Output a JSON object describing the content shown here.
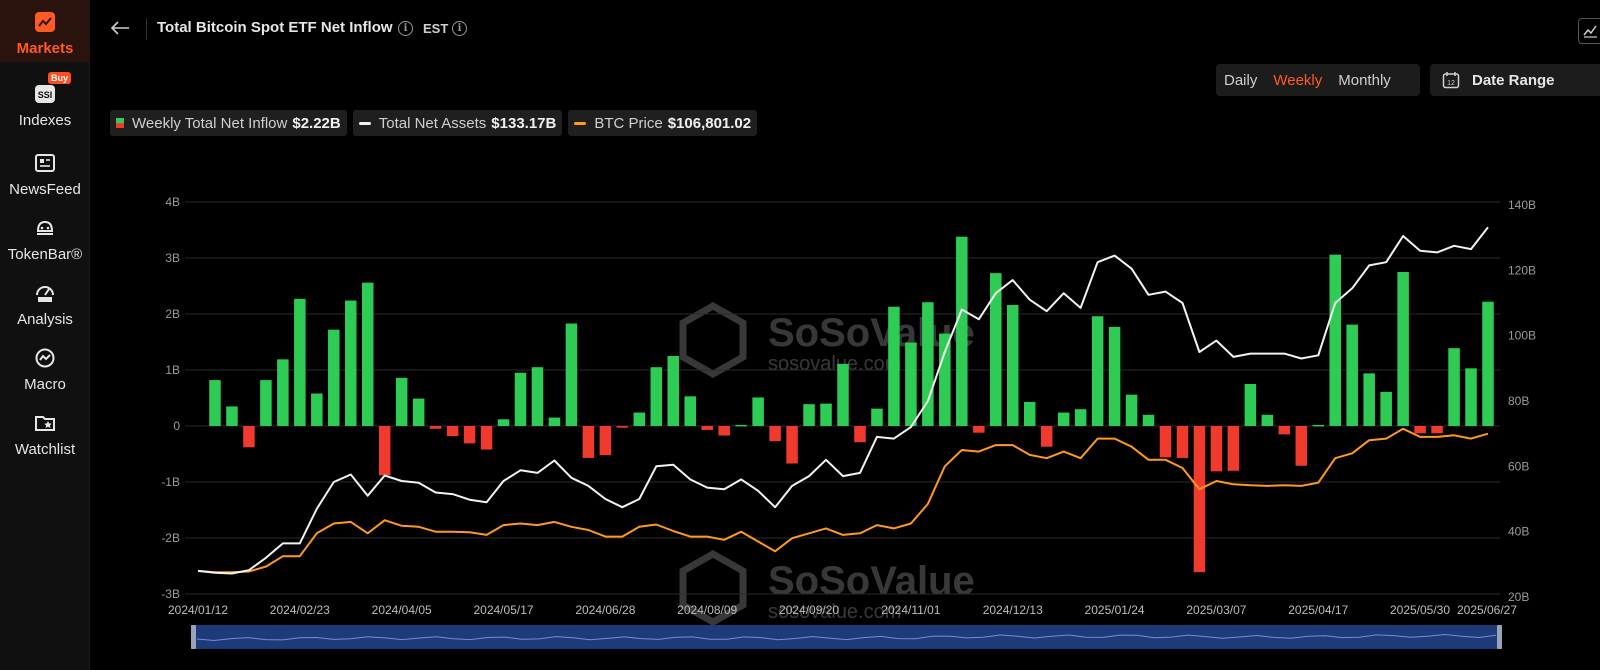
{
  "sidebar": {
    "items": [
      {
        "label": "Markets",
        "icon": "chart-trend-icon",
        "active": true
      },
      {
        "label": "Indexes",
        "icon": "ssi-index-icon",
        "badge": "Buy"
      },
      {
        "label": "NewsFeed",
        "icon": "newspaper-icon"
      },
      {
        "label": "TokenBar®",
        "icon": "tokenbar-icon"
      },
      {
        "label": "Analysis",
        "icon": "data-gauge-icon"
      },
      {
        "label": "Macro",
        "icon": "macro-icon"
      },
      {
        "label": "Watchlist",
        "icon": "watchlist-folder-icon"
      }
    ]
  },
  "header": {
    "title": "Total Bitcoin Spot ETF Net Inflow",
    "timezone": "EST"
  },
  "period_tabs": [
    {
      "label": "Daily",
      "active": false
    },
    {
      "label": "Weekly",
      "active": true
    },
    {
      "label": "Monthly",
      "active": false
    }
  ],
  "date_range": {
    "label": "Date Range",
    "icon_text": "12"
  },
  "legend": [
    {
      "name": "Weekly Total Net Inflow",
      "value": "$2.22B"
    },
    {
      "name": "Total Net Assets",
      "value": "$133.17B"
    },
    {
      "name": "BTC Price",
      "value": "$106,801.02"
    }
  ],
  "watermark": {
    "brand": "SoSoValue",
    "domain": "sosovalue.com"
  },
  "colors": {
    "accent": "#ff5a24",
    "inflow_positive": "#2ecc55",
    "inflow_negative": "#f03a2e",
    "net_assets_line": "#f2f2f2",
    "btc_price_line": "#ff9a1f"
  },
  "chart_data": {
    "type": "bar",
    "title": "Total Bitcoin Spot ETF Net Inflow",
    "left_axis": {
      "ticks": [
        "-3B",
        "-2B",
        "-1B",
        "0",
        "1B",
        "2B",
        "3B",
        "4B"
      ],
      "range": [
        -3,
        4
      ],
      "unit": "B"
    },
    "right_axis": {
      "ticks": [
        "20B",
        "40B",
        "60B",
        "80B",
        "100B",
        "120B",
        "140B"
      ],
      "range": [
        20,
        140
      ],
      "unit": "B"
    },
    "x_tick_labels": [
      "2024/01/12",
      "2024/02/23",
      "2024/04/05",
      "2024/05/17",
      "2024/06/28",
      "2024/08/09",
      "2024/09/20",
      "2024/11/01",
      "2024/12/13",
      "2025/01/24",
      "2025/03/07",
      "2025/04/17",
      "2025/05/30",
      "2025/06/27"
    ],
    "x_tick_week_index": [
      0,
      6,
      12,
      18,
      24,
      30,
      36,
      42,
      48,
      54,
      60,
      66,
      72,
      76
    ],
    "grid": true,
    "series": [
      {
        "name": "Weekly Total Net Inflow",
        "type": "bar",
        "unit": "B",
        "values": [
          0.82,
          0.35,
          -0.38,
          0.82,
          1.19,
          2.27,
          0.58,
          1.72,
          2.24,
          2.56,
          -0.88,
          0.86,
          0.49,
          -0.05,
          -0.18,
          -0.31,
          -0.42,
          0.12,
          0.95,
          1.05,
          0.15,
          1.83,
          -0.57,
          -0.52,
          -0.03,
          0.24,
          1.05,
          1.25,
          0.53,
          -0.07,
          -0.17,
          0.02,
          0.51,
          -0.27,
          -0.67,
          0.39,
          0.4,
          1.11,
          -0.29,
          0.31,
          2.13,
          1.49,
          2.21,
          1.65,
          3.38,
          -0.12,
          2.73,
          2.16,
          0.43,
          -0.37,
          0.24,
          0.3,
          1.96,
          1.77,
          0.56,
          0.2,
          -0.56,
          -0.57,
          -2.61,
          -0.81,
          -0.8,
          0.75,
          0.2,
          -0.15,
          -0.71,
          0.02,
          3.06,
          1.81,
          0.94,
          0.61,
          2.75,
          -0.13,
          -0.13,
          1.39,
          1.03,
          2.22
        ]
      },
      {
        "name": "Total Net Assets",
        "type": "line",
        "unit": "B",
        "values": [
          28,
          27.4,
          27.2,
          28.2,
          32,
          36.4,
          36.4,
          47,
          55.2,
          57.5,
          51,
          57.2,
          55.5,
          55,
          52,
          51.5,
          49.8,
          49,
          55.5,
          58.8,
          58,
          61.8,
          56.5,
          54,
          50,
          47.5,
          50,
          60,
          60.5,
          56,
          53.5,
          53,
          56,
          52.5,
          47.5,
          54,
          57,
          62,
          57,
          58,
          69,
          68.5,
          72,
          80,
          95,
          108,
          105,
          113,
          117,
          111,
          107.5,
          113,
          108.5,
          122.5,
          124.5,
          120.5,
          112.5,
          113.5,
          110,
          95,
          98.5,
          93.5,
          94.5,
          94.5,
          94.5,
          93,
          94,
          110,
          114.5,
          121.5,
          122.5,
          130.5,
          126,
          125.5,
          127.5,
          126.5,
          133.2
        ]
      },
      {
        "name": "BTC Price",
        "type": "line",
        "unit": "B",
        "values": [
          28,
          27.6,
          27.6,
          27.8,
          29.3,
          32.5,
          32.5,
          39.5,
          42.5,
          43,
          39.5,
          43.5,
          41.8,
          41.5,
          40,
          40,
          39.8,
          39,
          42,
          42.5,
          42,
          43,
          41.5,
          40.5,
          38.5,
          38.5,
          41.5,
          42.2,
          40.2,
          38.5,
          38.5,
          37.5,
          40,
          37,
          34,
          38,
          39.5,
          41,
          39,
          39.5,
          42,
          41,
          42.5,
          48.5,
          60,
          65,
          64.5,
          66.5,
          66.5,
          63.5,
          62.5,
          64.5,
          62.5,
          68.5,
          68.5,
          66,
          62,
          62,
          59.5,
          53,
          55.5,
          54.5,
          54.2,
          54,
          54.2,
          54,
          55,
          62.5,
          64,
          68,
          68.5,
          71.5,
          69,
          69,
          69.5,
          68.5,
          70
        ]
      }
    ]
  }
}
